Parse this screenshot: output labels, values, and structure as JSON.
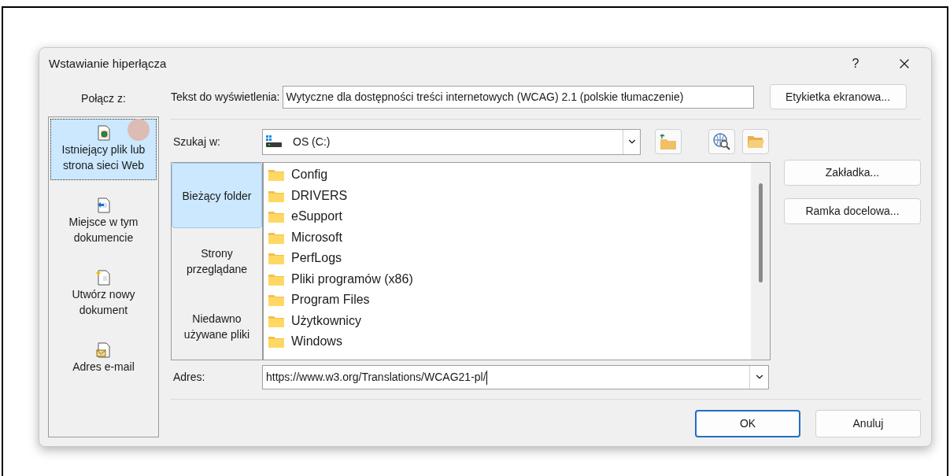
{
  "window": {
    "title": "Wstawianie hiperłącza",
    "help": "?"
  },
  "link_to": {
    "label": "Połącz z:",
    "items": [
      {
        "label": "Istniejący plik lub strona sieci Web",
        "kind": "web",
        "selected": true
      },
      {
        "label": "Miejsce w tym dokumencie",
        "kind": "place",
        "selected": false
      },
      {
        "label": "Utwórz nowy dokument",
        "kind": "new",
        "selected": false
      },
      {
        "label": "Adres e-mail",
        "kind": "email",
        "selected": false
      }
    ]
  },
  "display_text": {
    "label": "Tekst do wyświetlenia:",
    "value": "Wytyczne dla dostępności treści internetowych (WCAG) 2.1 (polskie tłumaczenie)"
  },
  "screen_tip_button": "Etykietka ekranowa...",
  "look_in": {
    "label": "Szukaj w:",
    "value": "OS (C:)"
  },
  "browse_tabs": [
    {
      "label": "Bieżący folder",
      "selected": true
    },
    {
      "label": "Strony przeglądane",
      "selected": false
    },
    {
      "label": "Niedawno używane pliki",
      "selected": false
    }
  ],
  "folders": [
    {
      "name": "Config"
    },
    {
      "name": "DRIVERS"
    },
    {
      "name": "eSupport"
    },
    {
      "name": "Microsoft"
    },
    {
      "name": "PerfLogs"
    },
    {
      "name": "Pliki programów (x86)"
    },
    {
      "name": "Program Files"
    },
    {
      "name": "Użytkownicy"
    },
    {
      "name": "Windows"
    }
  ],
  "side_buttons": [
    "Zakładka...",
    "Ramka docelowa..."
  ],
  "address": {
    "label": "Adres:",
    "value": "https://www.w3.org/Translations/WCAG21-pl/"
  },
  "buttons": [
    {
      "label": "OK",
      "default": true
    },
    {
      "label": "Anuluj",
      "default": false
    }
  ]
}
